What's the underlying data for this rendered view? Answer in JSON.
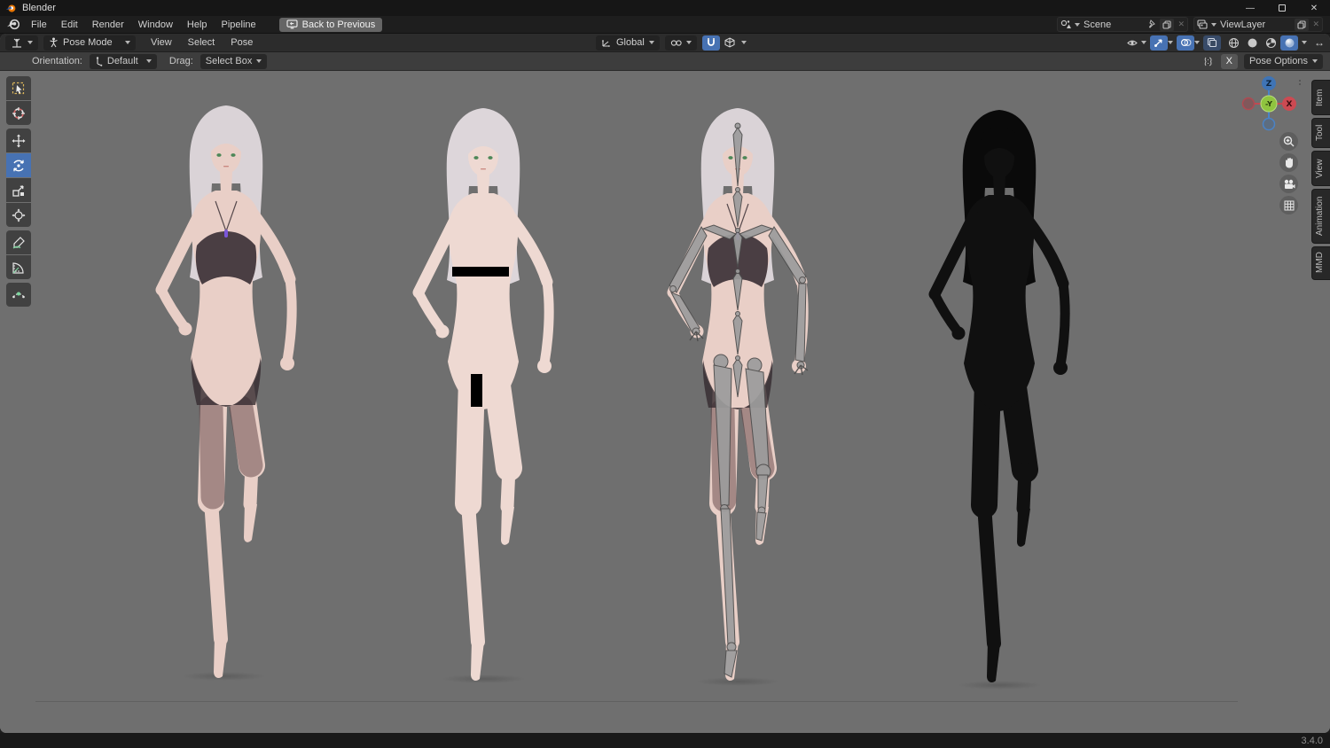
{
  "window": {
    "title": "Blender"
  },
  "icons": {
    "close": "✕",
    "minimize": "—",
    "swap": "↔",
    "x_small": "✕"
  },
  "menubar": {
    "items": [
      "File",
      "Edit",
      "Render",
      "Window",
      "Help",
      "Pipeline"
    ],
    "back_to_previous": "Back to Previous",
    "scene_selector": {
      "value": "Scene"
    },
    "view_layer_selector": {
      "value": "ViewLayer"
    }
  },
  "viewport_header": {
    "mode_selector": "Pose Mode",
    "menus": [
      "View",
      "Select",
      "Pose"
    ],
    "transform_orientation": "Global"
  },
  "tool_settings": {
    "orientation_label": "Orientation:",
    "orientation_value": "Default",
    "drag_label": "Drag:",
    "drag_value": "Select Box",
    "clear_button": "X",
    "pose_options_button": "Pose Options"
  },
  "toolbar_tools": [
    "select-box",
    "cursor",
    "move",
    "rotate",
    "scale",
    "transform",
    "annotate",
    "measure",
    "pose-breakdowner"
  ],
  "active_tool": "rotate",
  "navigation_gizmo": {
    "z_label": "Z",
    "x_label": "X",
    "center_label": "-Y"
  },
  "sidebar_tabs": [
    "Item",
    "Tool",
    "View",
    "Animation",
    "MMD"
  ],
  "viewport_figures": [
    "textured-clothed-model",
    "textured-censored-model",
    "armature-overlay-model",
    "wireframe-model"
  ],
  "status_bar": {
    "version": "3.4.0"
  },
  "colors": {
    "accent_blue": "#4772b3",
    "viewport_background": "#6f6f6f",
    "blender_orange": "#ea7600",
    "axis_x_red": "#cc4a52",
    "axis_y_green": "#8fc43f",
    "axis_z_blue": "#4a83c6",
    "censor_bar": "#000000"
  }
}
